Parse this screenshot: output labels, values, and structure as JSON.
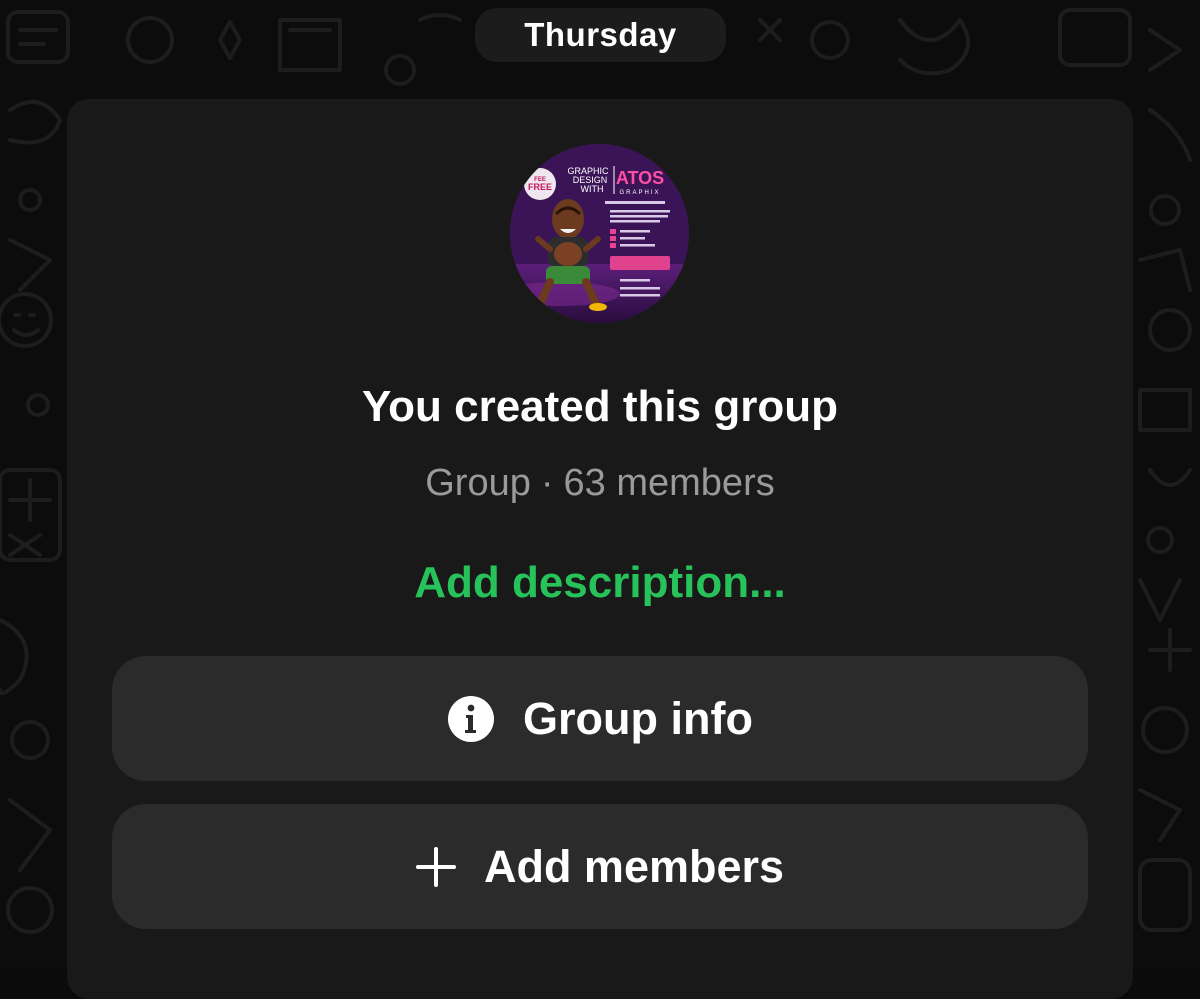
{
  "date_separator": "Thursday",
  "group": {
    "created_text": "You created this group",
    "type_label": "Group",
    "separator": "·",
    "members_text": "63 members",
    "add_description_label": "Add description...",
    "avatar": {
      "poster_lines": [
        "GRAPHIC",
        "DESIGN",
        "WITH",
        "ATOS",
        "GRAPHIX",
        "FEE",
        "FREE"
      ]
    }
  },
  "actions": {
    "group_info_label": "Group info",
    "add_members_label": "Add members"
  },
  "icons": {
    "group_info": "info-circle-icon",
    "add_members": "plus-icon"
  },
  "colors": {
    "accent": "#27c25a",
    "background": "#0c0c0c",
    "card": "#191919",
    "button": "#2b2b2b",
    "secondary_text": "#9a9a9a"
  }
}
